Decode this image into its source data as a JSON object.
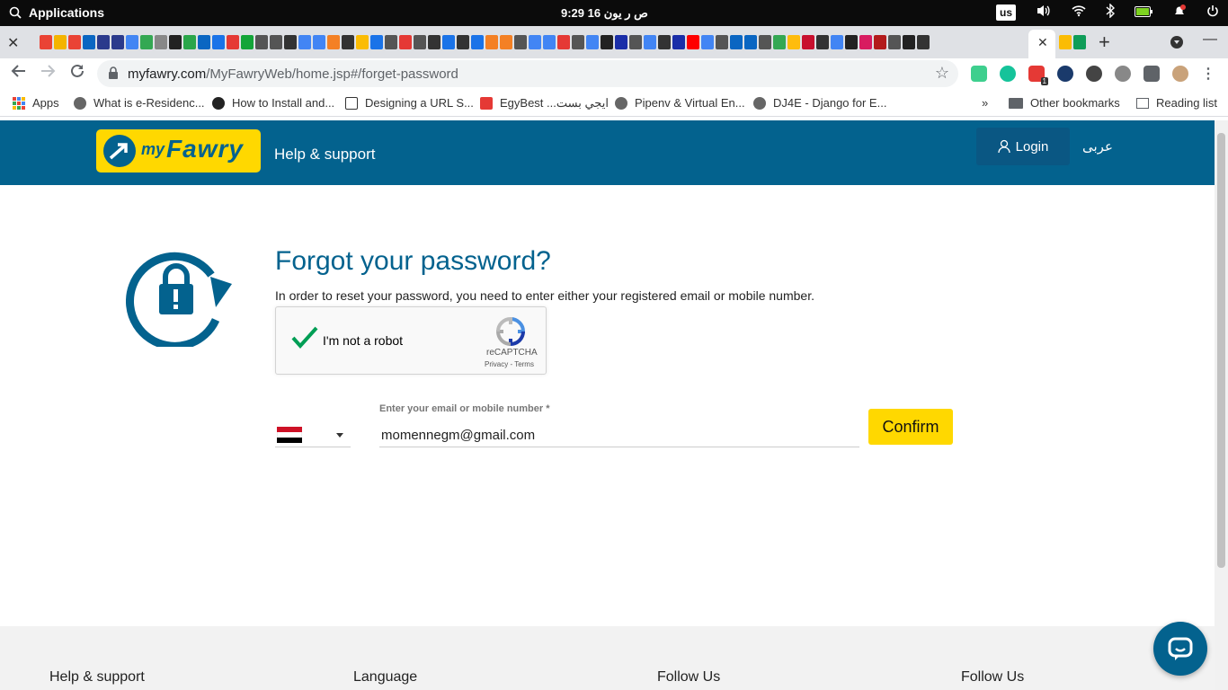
{
  "os": {
    "apps_label": "Applications",
    "clock": "9:29 ص     ر يون 16",
    "keyboard_layout": "us"
  },
  "browser": {
    "url_host": "myfawry.com",
    "url_path": "/MyFawryWeb/home.jsp#/forget-password",
    "bookmarks": {
      "apps": "Apps",
      "b1": "What is e-Residenc...",
      "b2": "How to Install and...",
      "b3": "Designing a URL S...",
      "b4": "EgyBest ...ايجي بست",
      "b5": "Pipenv & Virtual En...",
      "b6": "DJ4E - Django for E...",
      "overflow": "»",
      "other": "Other bookmarks",
      "reading": "Reading list"
    },
    "extension_badge": "1"
  },
  "header": {
    "logo_my": "my",
    "logo_fawry": "Fawry",
    "help": "Help & support",
    "login": "Login",
    "language": "عربى"
  },
  "main": {
    "title": "Forgot your password?",
    "subtitle": "In order to reset your password, you need to enter either your registered email or mobile number.",
    "recaptcha": {
      "label": "I'm not a robot",
      "brand": "reCAPTCHA",
      "terms": "Privacy - Terms"
    },
    "field_label": "Enter your email or mobile number *",
    "email_value": "momennegm@gmail.com",
    "confirm": "Confirm"
  },
  "footer": {
    "col1": "Help & support",
    "col2": "Language",
    "col3": "Follow Us",
    "col4": "Follow Us"
  },
  "colors": {
    "brand_blue": "#03628e",
    "brand_yellow": "#ffd800"
  }
}
